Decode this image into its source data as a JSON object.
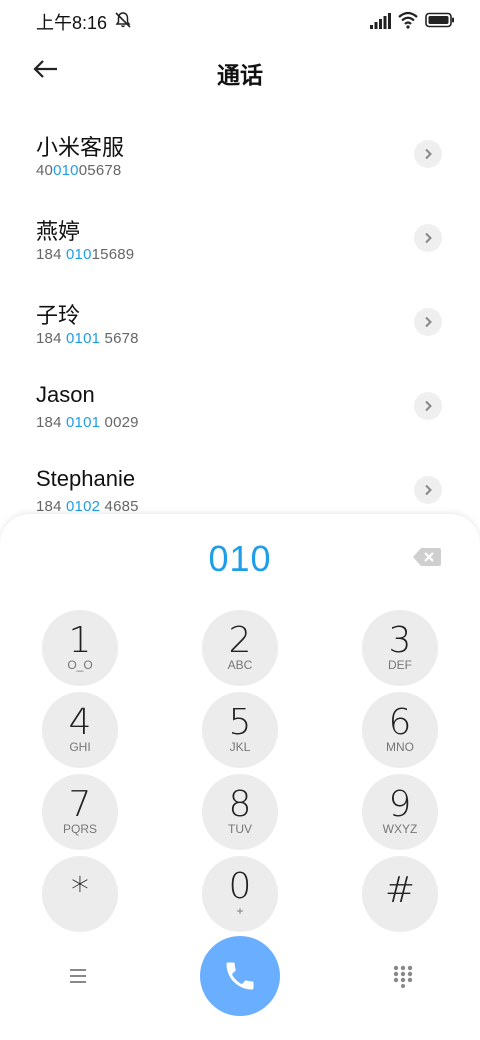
{
  "status_bar": {
    "time": "上午8:16"
  },
  "header": {
    "title": "通话"
  },
  "contacts": [
    {
      "name": "小米客服",
      "number_pre": "40",
      "number_match": "010",
      "number_post": "05678"
    },
    {
      "name": "燕婷",
      "number_pre": "184 ",
      "number_match": "010",
      "number_post": "15689"
    },
    {
      "name": "子玲",
      "number_pre": "184 ",
      "number_match": "0101",
      "number_post": " 5678"
    },
    {
      "name": "Jason",
      "number_pre": "184 ",
      "number_match": "0101",
      "number_post": " 0029"
    },
    {
      "name": "Stephanie",
      "number_pre": "184 ",
      "number_match": "0102",
      "number_post": " 4685"
    }
  ],
  "dialpad": {
    "input": "010",
    "keys": [
      {
        "digit": "1",
        "letters": "O_O"
      },
      {
        "digit": "2",
        "letters": "ABC"
      },
      {
        "digit": "3",
        "letters": "DEF"
      },
      {
        "digit": "4",
        "letters": "GHI"
      },
      {
        "digit": "5",
        "letters": "JKL"
      },
      {
        "digit": "6",
        "letters": "MNO"
      },
      {
        "digit": "7",
        "letters": "PQRS"
      },
      {
        "digit": "8",
        "letters": "TUV"
      },
      {
        "digit": "9",
        "letters": "WXYZ"
      },
      {
        "digit": "*",
        "letters": ""
      },
      {
        "digit": "0",
        "letters": "+"
      },
      {
        "digit": "#",
        "letters": ""
      }
    ]
  },
  "colors": {
    "accent": "#1f9ee8",
    "call_button": "#6aafff",
    "key_bg": "#ececec"
  },
  "icons": [
    "bell-muted-icon",
    "signal-icon",
    "wifi-icon",
    "battery-icon",
    "back-arrow-icon",
    "chevron-right-icon",
    "backspace-icon",
    "menu-icon",
    "phone-icon",
    "dialpad-grid-icon"
  ]
}
